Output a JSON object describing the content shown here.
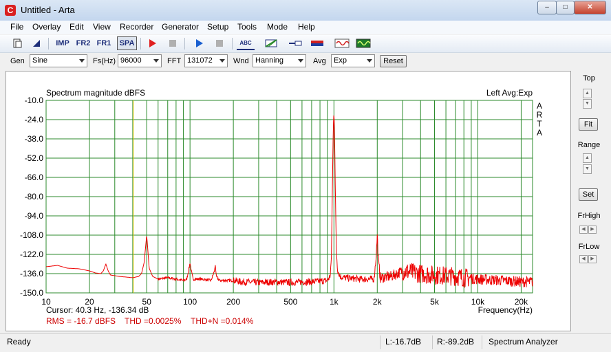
{
  "window": {
    "title": "Untitled - Arta",
    "icon_letter": "C",
    "minimize": "–",
    "maximize": "□",
    "close": "✕"
  },
  "menu": [
    "File",
    "Overlay",
    "Edit",
    "View",
    "Recorder",
    "Generator",
    "Setup",
    "Tools",
    "Mode",
    "Help"
  ],
  "toolbar": [
    {
      "name": "new-file-icon",
      "label": ""
    },
    {
      "name": "marker-icon",
      "label": ""
    },
    {
      "name": "imp-mode-button",
      "label": "IMP"
    },
    {
      "name": "fr2-mode-button",
      "label": "FR2"
    },
    {
      "name": "fr1-mode-button",
      "label": "FR1"
    },
    {
      "name": "spa-mode-button",
      "label": "SPA"
    },
    {
      "name": "record-play-icon",
      "label": ""
    },
    {
      "name": "record-stop-icon",
      "label": ""
    },
    {
      "name": "generator-play-icon",
      "label": ""
    },
    {
      "name": "generator-stop-icon",
      "label": ""
    },
    {
      "name": "text-tool-icon",
      "label": "ABC"
    },
    {
      "name": "grid-icon",
      "label": ""
    },
    {
      "name": "probe-icon",
      "label": ""
    },
    {
      "name": "level-meter-icon",
      "label": ""
    },
    {
      "name": "sine-generator-icon",
      "label": ""
    },
    {
      "name": "scope-icon",
      "label": ""
    }
  ],
  "params": {
    "gen_label": "Gen",
    "gen_value": "Sine",
    "fs_label": "Fs(Hz)",
    "fs_value": "96000",
    "fft_label": "FFT",
    "fft_value": "131072",
    "wnd_label": "Wnd",
    "wnd_value": "Hanning",
    "avg_label": "Avg",
    "avg_value": "Exp",
    "reset_label": "Reset"
  },
  "side": {
    "top_label": "Top",
    "fit_label": "Fit",
    "range_label": "Range",
    "set_label": "Set",
    "frhigh_label": "FrHigh",
    "frlow_label": "FrLow"
  },
  "colors": {
    "trace": "#ee0000",
    "grid": "#2b8a2b",
    "cursor": "#d6c400",
    "info_red": "#cc0000"
  },
  "chart_data": {
    "type": "line",
    "title": "Spectrum magnitude dBFS",
    "header_right": "Left  Avg:Exp",
    "brand": "ARTA",
    "xlabel": "Frequency(Hz)",
    "xscale": "log",
    "xlim": [
      10,
      24000
    ],
    "ylim": [
      -150,
      -10
    ],
    "x_ticks": [
      "10",
      "20",
      "50",
      "100",
      "200",
      "500",
      "1k",
      "2k",
      "5k",
      "10k",
      "20k"
    ],
    "y_ticks": [
      "-10.0",
      "-24.0",
      "-38.0",
      "-52.0",
      "-66.0",
      "-80.0",
      "-94.0",
      "-108.0",
      "-122.0",
      "-136.0",
      "-150.0"
    ],
    "cursor_hz": 40.3,
    "cursor_text": "Cursor:   40.3 Hz, -136.34 dB",
    "rms_text": "RMS =  -16.7 dBFS",
    "thd_text": "THD =0.0025%",
    "thdn_text": "THD+N =0.014%",
    "series": [
      {
        "values": [
          [
            10,
            -131
          ],
          [
            12,
            -130
          ],
          [
            14,
            -132
          ],
          [
            17,
            -132.5
          ],
          [
            20,
            -134
          ],
          [
            22,
            -135.5
          ],
          [
            24,
            -136
          ],
          [
            25,
            -134
          ],
          [
            26,
            -129
          ],
          [
            27,
            -134
          ],
          [
            28,
            -137
          ],
          [
            32,
            -138
          ],
          [
            36,
            -138.5
          ],
          [
            40,
            -139
          ],
          [
            44,
            -138
          ],
          [
            46,
            -136
          ],
          [
            48,
            -128
          ],
          [
            49,
            -118
          ],
          [
            50,
            -108
          ],
          [
            51,
            -120
          ],
          [
            52,
            -132
          ],
          [
            55,
            -138
          ],
          [
            60,
            -140
          ],
          [
            70,
            -139
          ],
          [
            80,
            -140
          ],
          [
            90,
            -141
          ],
          [
            95,
            -140
          ],
          [
            98,
            -133
          ],
          [
            100,
            -128
          ],
          [
            102,
            -134
          ],
          [
            105,
            -140
          ],
          [
            120,
            -140
          ],
          [
            140,
            -141
          ],
          [
            148,
            -134
          ],
          [
            150,
            -129
          ],
          [
            152,
            -138
          ],
          [
            160,
            -141
          ],
          [
            200,
            -141
          ],
          [
            230,
            -142
          ],
          [
            300,
            -142.5
          ],
          [
            400,
            -142
          ],
          [
            500,
            -142.5
          ],
          [
            600,
            -142
          ],
          [
            700,
            -142
          ],
          [
            800,
            -141.5
          ],
          [
            900,
            -141
          ],
          [
            940,
            -138
          ],
          [
            960,
            -125
          ],
          [
            980,
            -60
          ],
          [
            990,
            -30
          ],
          [
            1000,
            -18
          ],
          [
            1010,
            -30
          ],
          [
            1020,
            -70
          ],
          [
            1040,
            -120
          ],
          [
            1060,
            -133
          ],
          [
            1100,
            -138
          ],
          [
            1200,
            -139
          ],
          [
            1500,
            -140
          ],
          [
            1900,
            -140
          ],
          [
            1960,
            -125
          ],
          [
            2000,
            -108
          ],
          [
            2040,
            -128
          ],
          [
            2100,
            -139
          ],
          [
            2500,
            -138
          ],
          [
            3000,
            -134
          ],
          [
            4000,
            -136
          ],
          [
            5000,
            -137
          ],
          [
            7000,
            -138
          ],
          [
            10000,
            -140
          ],
          [
            15000,
            -141
          ],
          [
            20000,
            -142
          ],
          [
            24000,
            -142
          ]
        ]
      }
    ]
  },
  "status": {
    "ready": "Ready",
    "left_level": "L:-16.7dB",
    "right_level": "R:-89.2dB",
    "mode": "Spectrum Analyzer"
  }
}
